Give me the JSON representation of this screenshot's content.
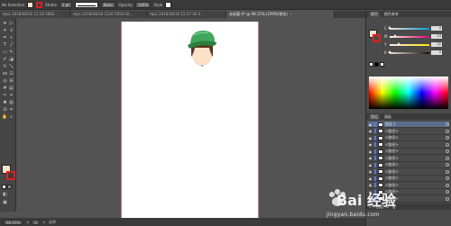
{
  "control_bar": {
    "selection_label": "No Selection",
    "fill_color": "#fbe1c8",
    "stroke_color": "#d42222",
    "stroke_label": "Stroke",
    "stroke_weight": "1 pt",
    "profile_label": "Basic",
    "opacity_label": "Opacity",
    "opacity_value": "100%",
    "style_label": "Style"
  },
  "tabs": [
    {
      "label": "Hpic 2018/08/16 15:26 5860...",
      "active": false
    },
    {
      "label": "Hpic 2018/08/16 1536 5858 50...",
      "active": false
    },
    {
      "label": "Hpic 2018/08/16 15-57 56.0 ...",
      "active": false
    },
    {
      "label": "未标题-4* @ 98.15% (CMYK/预览)",
      "active": true
    }
  ],
  "toolbox": {
    "fill_color": "#fbe1c8",
    "stroke_color": "#d42222"
  },
  "status_bar": {
    "zoom": "98.15%",
    "artboard_nav": "1",
    "tool_label": "选择"
  },
  "color_panel": {
    "tabs": [
      "颜色",
      "颜色参考"
    ],
    "channels": [
      {
        "name": "C",
        "value": "0",
        "fraction": 0.0
      },
      {
        "name": "M",
        "value": "13",
        "fraction": 0.13
      },
      {
        "name": "Y",
        "value": "22",
        "fraction": 0.22
      },
      {
        "name": "K",
        "value": "0",
        "fraction": 0.0
      }
    ]
  },
  "layers_panel": {
    "tabs": [
      "图层",
      "画板"
    ],
    "layers": [
      {
        "name": "图层 1",
        "color": "#4c7be8",
        "selected": true
      },
      {
        "name": "<路径>",
        "color": "#4c7be8",
        "selected": false
      },
      {
        "name": "<路径>",
        "color": "#4c7be8",
        "selected": false
      },
      {
        "name": "<路径>",
        "color": "#4c7be8",
        "selected": false
      },
      {
        "name": "<路径>",
        "color": "#4c7be8",
        "selected": false
      },
      {
        "name": "<路径>",
        "color": "#4c7be8",
        "selected": false
      },
      {
        "name": "<路径>",
        "color": "#4c7be8",
        "selected": false
      },
      {
        "name": "<路径>",
        "color": "#4c7be8",
        "selected": false
      },
      {
        "name": "<路径>",
        "color": "#4c7be8",
        "selected": false
      },
      {
        "name": "<路径>",
        "color": "#4c7be8",
        "selected": false
      },
      {
        "name": "<路径>",
        "color": "#4c7be8",
        "selected": false
      },
      {
        "name": "<路径>",
        "color": "#4c7be8",
        "selected": false
      }
    ],
    "footer_label": "1 个图层"
  },
  "watermark": {
    "brand": "Bai 经验",
    "url": "jingyan.baidu.com"
  }
}
